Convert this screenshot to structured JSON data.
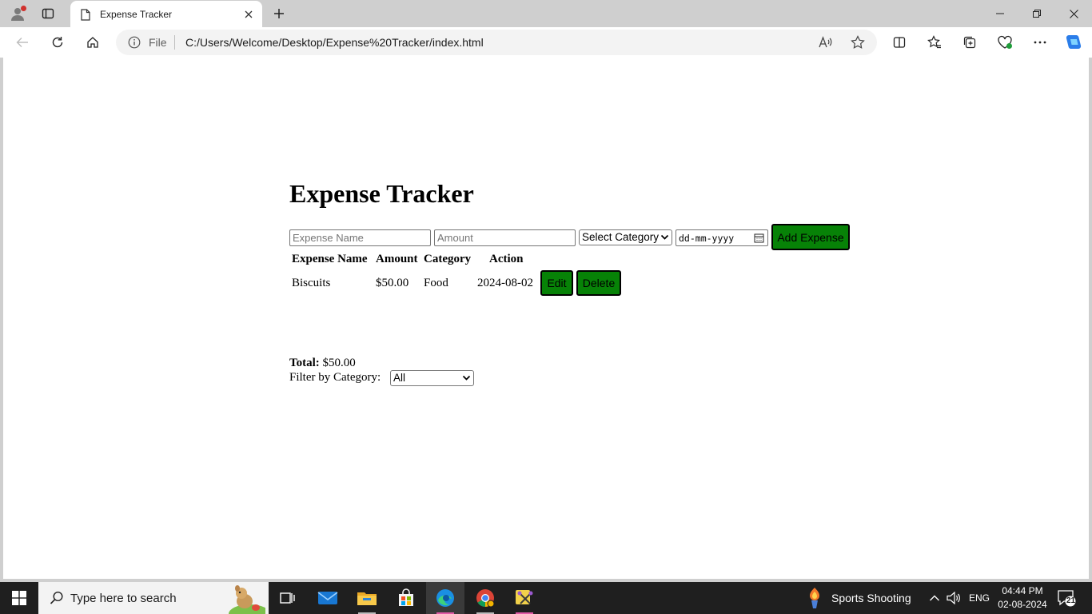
{
  "browser": {
    "tab_title": "Expense Tracker",
    "url_scheme": "File",
    "url": "C:/Users/Welcome/Desktop/Expense%20Tracker/index.html"
  },
  "app": {
    "heading": "Expense Tracker",
    "form": {
      "name_placeholder": "Expense Name",
      "amount_placeholder": "Amount",
      "category_selected": "Select Category",
      "date_placeholder": "dd-mm-yyyy",
      "add_label": "Add Expense"
    },
    "table": {
      "headers": [
        "Expense Name",
        "Amount",
        "Category",
        "Action"
      ],
      "rows": [
        {
          "name": "Biscuits",
          "amount": "$50.00",
          "category": "Food",
          "date": "2024-08-02",
          "edit_label": "Edit",
          "delete_label": "Delete"
        }
      ]
    },
    "total_label": "Total:",
    "total_value": "$50.00",
    "filter_label": "Filter by Category:",
    "filter_selected": "All"
  },
  "taskbar": {
    "search_placeholder": "Type here to search",
    "weather_text": "Sports Shooting",
    "language": "ENG",
    "time": "04:44 PM",
    "date": "02-08-2024",
    "notification_count": "21"
  },
  "colors": {
    "button_green": "#078207",
    "taskbar": "#1f1f1f",
    "chrome": "#cfcfcf"
  }
}
